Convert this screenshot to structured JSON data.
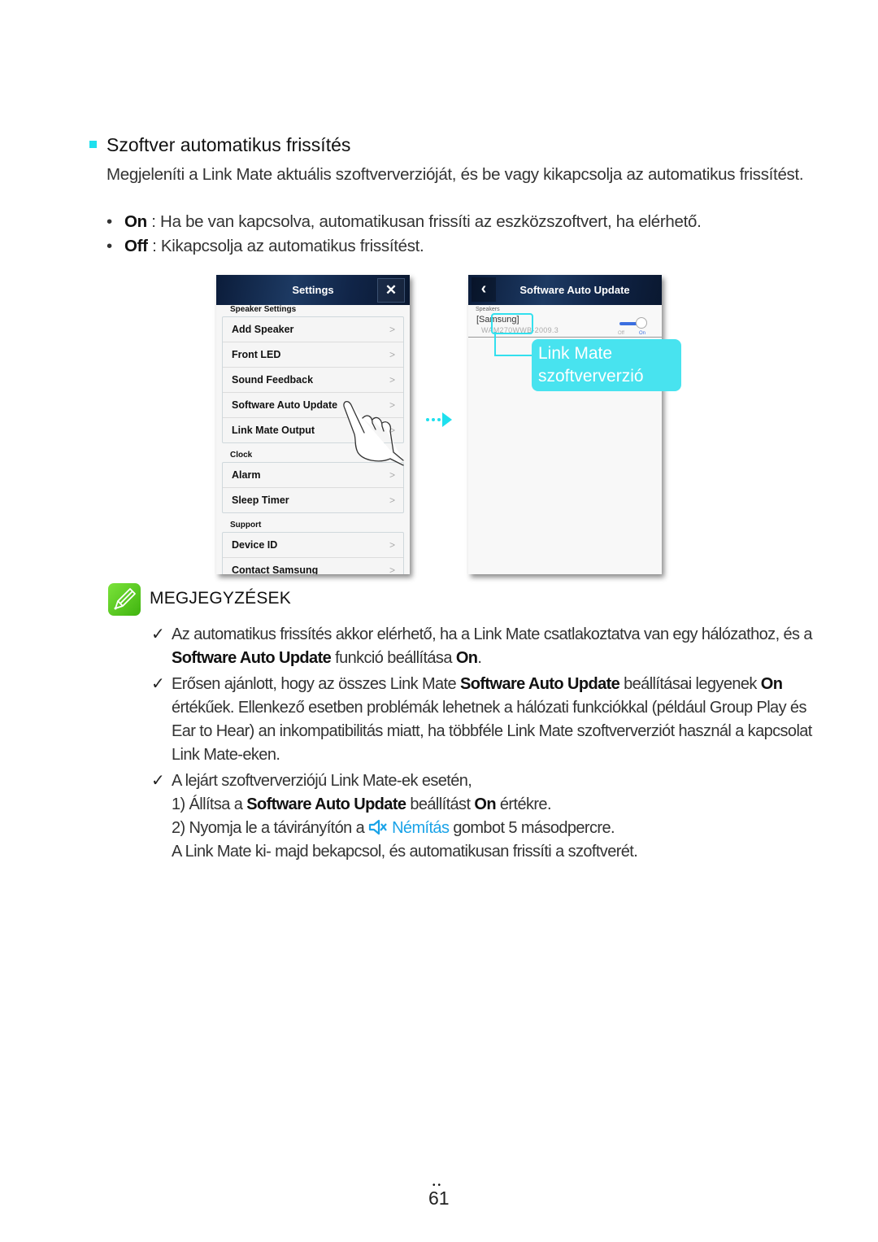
{
  "section": {
    "title": "Szoftver automatikus frissítés",
    "description": "Megjeleníti a Link Mate aktuális szoftververzióját, és be vagy kikapcsolja az automatikus frissítést.",
    "bullets": [
      {
        "term": "On",
        "text": " : Ha be van kapcsolva, automatikusan frissíti az eszközszoftvert, ha elérhető."
      },
      {
        "term": "Off",
        "text": " : Kikapcsolja az automatikus frissítést."
      }
    ]
  },
  "screen1": {
    "title": "Settings",
    "close_icon": "close-icon",
    "groups": [
      {
        "label": "Speaker Settings",
        "items": [
          "Add Speaker",
          "Front LED",
          "Sound Feedback",
          "Software Auto Update",
          "Link Mate Output"
        ]
      },
      {
        "label": "Clock",
        "items": [
          "Alarm",
          "Sleep Timer"
        ]
      },
      {
        "label": "Support",
        "items": [
          "Device ID",
          "Contact Samsung"
        ]
      }
    ],
    "chevron": ">"
  },
  "screen2": {
    "title": "Software Auto Update",
    "back_icon": "back-icon",
    "group_label": "Speakers",
    "speaker_name": "[Samsung]",
    "speaker_version": "WAM270WWB-2009.3",
    "toggle_off_label": "Off",
    "toggle_on_label": "On",
    "toggle_state": "On"
  },
  "callout": {
    "line1": "Link Mate",
    "line2": "szoftververzió"
  },
  "notes": {
    "title": "MEGJEGYZÉSEK",
    "check": "✓",
    "items": [
      {
        "a": "Az automatikus frissítés akkor elérhető, ha a Link Mate csatlakoztatva van egy hálózathoz, és a ",
        "b": "Software Auto Update",
        "c": " funkció beállítása ",
        "d": "On",
        "e": "."
      },
      {
        "a": "Erősen ajánlott, hogy az összes Link Mate ",
        "b": "Software Auto Update",
        "c": " beállításai legyenek ",
        "d": "On",
        "e": " értékűek. Ellenkező esetben problémák lehetnek a hálózati funkciókkal (például Group Play és Ear to Hear) an inkompatibilitás miatt, ha többféle Link Mate szoftververziót használ a kapcsolat Link Mate-eken."
      }
    ],
    "item3": {
      "intro": "A lejárt szoftververziójú Link Mate-ek esetén,",
      "step1_a": "1) Állítsa a ",
      "step1_b": "Software Auto Update",
      "step1_c": " beállítást ",
      "step1_d": "On",
      "step1_e": " értékre.",
      "step2_a": "2) Nyomja le a távirányítón a ",
      "step2_button": "Némítás",
      "step2_c": " gombot 5 másodpercre.",
      "step3": "A Link Mate ki- majd bekapcsol, és automatikusan frissíti a szoftverét."
    }
  },
  "page": {
    "dots": "••",
    "number": "61"
  },
  "colors": {
    "accent_cyan": "#33e0ee",
    "note_green": "#5ccb22",
    "mute_blue": "#1aa3e8"
  }
}
